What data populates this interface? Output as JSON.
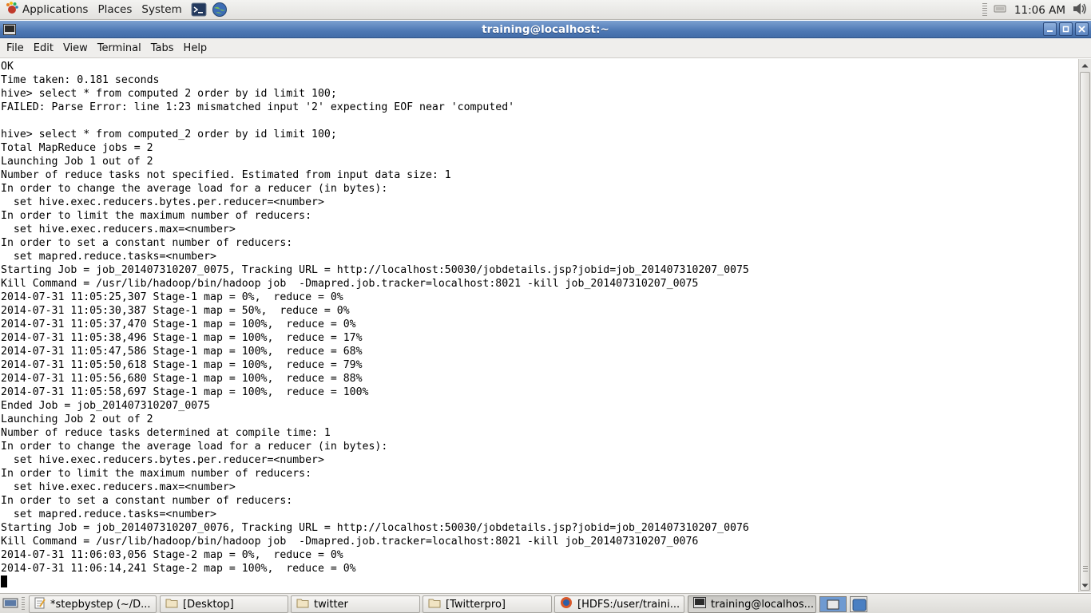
{
  "top_panel": {
    "menus": [
      "Applications",
      "Places",
      "System"
    ],
    "launchers": [
      "terminal-icon",
      "web-browser-icon"
    ],
    "clock": "11:06 AM",
    "tray_icons": [
      "network-icon",
      "volume-icon"
    ]
  },
  "window": {
    "title": "training@localhost:~",
    "controls": [
      "minimize",
      "maximize",
      "close"
    ]
  },
  "menubar": {
    "items": [
      {
        "label": "File"
      },
      {
        "label": "Edit"
      },
      {
        "label": "View"
      },
      {
        "label": "Terminal"
      },
      {
        "label": "Tabs"
      },
      {
        "label": "Help"
      }
    ]
  },
  "terminal": {
    "lines": [
      "OK",
      "Time taken: 0.181 seconds",
      "hive> select * from computed 2 order by id limit 100;",
      "FAILED: Parse Error: line 1:23 mismatched input '2' expecting EOF near 'computed'",
      "",
      "hive> select * from computed_2 order by id limit 100;",
      "Total MapReduce jobs = 2",
      "Launching Job 1 out of 2",
      "Number of reduce tasks not specified. Estimated from input data size: 1",
      "In order to change the average load for a reducer (in bytes):",
      "  set hive.exec.reducers.bytes.per.reducer=<number>",
      "In order to limit the maximum number of reducers:",
      "  set hive.exec.reducers.max=<number>",
      "In order to set a constant number of reducers:",
      "  set mapred.reduce.tasks=<number>",
      "Starting Job = job_201407310207_0075, Tracking URL = http://localhost:50030/jobdetails.jsp?jobid=job_201407310207_0075",
      "Kill Command = /usr/lib/hadoop/bin/hadoop job  -Dmapred.job.tracker=localhost:8021 -kill job_201407310207_0075",
      "2014-07-31 11:05:25,307 Stage-1 map = 0%,  reduce = 0%",
      "2014-07-31 11:05:30,387 Stage-1 map = 50%,  reduce = 0%",
      "2014-07-31 11:05:37,470 Stage-1 map = 100%,  reduce = 0%",
      "2014-07-31 11:05:38,496 Stage-1 map = 100%,  reduce = 17%",
      "2014-07-31 11:05:47,586 Stage-1 map = 100%,  reduce = 68%",
      "2014-07-31 11:05:50,618 Stage-1 map = 100%,  reduce = 79%",
      "2014-07-31 11:05:56,680 Stage-1 map = 100%,  reduce = 88%",
      "2014-07-31 11:05:58,697 Stage-1 map = 100%,  reduce = 100%",
      "Ended Job = job_201407310207_0075",
      "Launching Job 2 out of 2",
      "Number of reduce tasks determined at compile time: 1",
      "In order to change the average load for a reducer (in bytes):",
      "  set hive.exec.reducers.bytes.per.reducer=<number>",
      "In order to limit the maximum number of reducers:",
      "  set hive.exec.reducers.max=<number>",
      "In order to set a constant number of reducers:",
      "  set mapred.reduce.tasks=<number>",
      "Starting Job = job_201407310207_0076, Tracking URL = http://localhost:50030/jobdetails.jsp?jobid=job_201407310207_0076",
      "Kill Command = /usr/lib/hadoop/bin/hadoop job  -Dmapred.job.tracker=localhost:8021 -kill job_201407310207_0076",
      "2014-07-31 11:06:03,056 Stage-2 map = 0%,  reduce = 0%",
      "2014-07-31 11:06:14,241 Stage-2 map = 100%,  reduce = 0%"
    ]
  },
  "taskbar": {
    "tasks": [
      {
        "label": "*stepbystep (~/D...",
        "icon": "text-editor-icon"
      },
      {
        "label": "[Desktop]",
        "icon": "folder-icon"
      },
      {
        "label": "twitter",
        "icon": "folder-icon"
      },
      {
        "label": "[Twitterpro]",
        "icon": "folder-icon"
      },
      {
        "label": "[HDFS:/user/traini...",
        "icon": "firefox-icon"
      },
      {
        "label": "training@localhos...",
        "icon": "terminal-icon"
      }
    ],
    "workspaces": [
      "workspace-1",
      "workspace-2"
    ]
  }
}
